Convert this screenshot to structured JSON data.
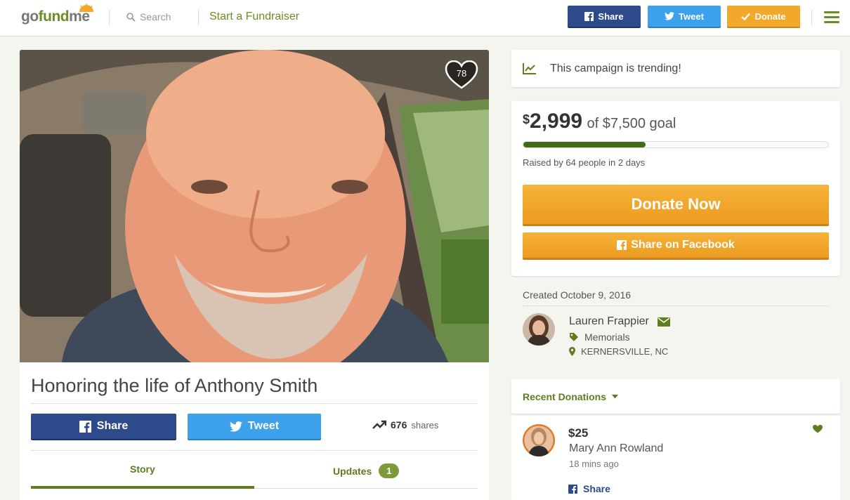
{
  "header": {
    "logo": {
      "part1": "go",
      "part2": "fund",
      "part3": "me"
    },
    "search_label": "Search",
    "start_fundraiser": "Start a Fundraiser",
    "share_label": "Share",
    "tweet_label": "Tweet",
    "donate_label": "Donate"
  },
  "campaign": {
    "heart_count": "78",
    "title": "Honoring the life of Anthony Smith",
    "share_label": "Share",
    "tweet_label": "Tweet",
    "shares_count": "676",
    "shares_label": "shares",
    "tabs": [
      {
        "label": "Story",
        "active": true
      },
      {
        "label": "Updates",
        "badge": "1",
        "active": false
      }
    ]
  },
  "sidebar": {
    "trending_text": "This campaign is trending!",
    "currency_symbol": "$",
    "raised_amount": "2,999",
    "goal_text": "of $7,500 goal",
    "progress_fraction": 0.3999,
    "raised_by": "Raised by 64 people in 2 days",
    "donate_now_label": "Donate Now",
    "share_facebook_label": "Share on Facebook",
    "created": "Created October 9, 2016",
    "organizer": {
      "name": "Lauren Frappier",
      "category": "Memorials",
      "location": "KERNERSVILLE, NC"
    },
    "recent_donations_label": "Recent Donations",
    "donations": [
      {
        "amount": "$25",
        "name": "Mary Ann Rowland",
        "time": "18 mins ago",
        "share_label": "Share"
      }
    ]
  },
  "colors": {
    "brand_green": "#6b8e23",
    "facebook_blue": "#2d4a8a",
    "twitter_blue": "#3ea1ec",
    "donate_orange": "#f2a82b",
    "progress_green": "#3f6b12"
  },
  "icons": [
    "logo-sun-icon",
    "search-icon",
    "facebook-icon",
    "twitter-icon",
    "check-icon",
    "menu-icon",
    "heart-icon",
    "trending-icon",
    "envelope-icon",
    "tag-icon",
    "location-pin-icon",
    "caret-down-icon"
  ]
}
